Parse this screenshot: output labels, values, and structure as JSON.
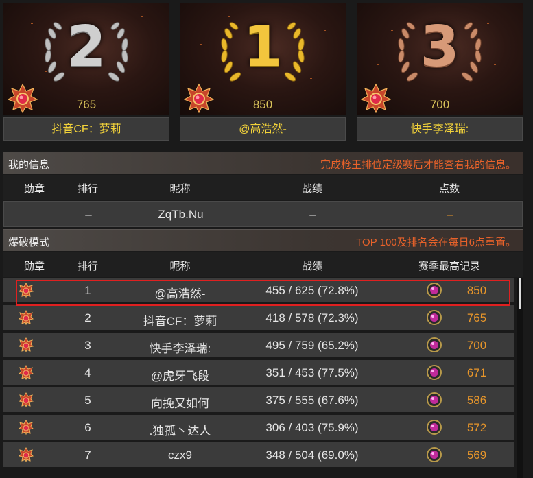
{
  "podium": [
    {
      "place": "2",
      "score": "765",
      "name": "抖音CF：萝莉"
    },
    {
      "place": "1",
      "score": "850",
      "name": "@高浩然-"
    },
    {
      "place": "3",
      "score": "700",
      "name": "快手李泽瑞:"
    }
  ],
  "my_info": {
    "title": "我的信息",
    "notice": "完成枪王排位定级赛后才能查看我的信息。",
    "headers": {
      "medal": "勋章",
      "rank": "排行",
      "name": "昵称",
      "record": "战绩",
      "points": "点数"
    },
    "row": {
      "rank": "–",
      "name": "ZqTb.Nu",
      "record": "–",
      "points": "–"
    }
  },
  "mode": {
    "title": "爆破模式",
    "notice": "TOP 100及排名会在每日6点重置。",
    "headers": {
      "medal": "勋章",
      "rank": "排行",
      "name": "昵称",
      "record": "战绩",
      "points": "赛季最高记录"
    }
  },
  "leaderboard": [
    {
      "rank": "1",
      "name": "@高浩然-",
      "record": "455 / 625 (72.8%)",
      "points": "850"
    },
    {
      "rank": "2",
      "name": "抖音CF：萝莉",
      "record": "418 / 578 (72.3%)",
      "points": "765"
    },
    {
      "rank": "3",
      "name": "快手李泽瑞:",
      "record": "495 / 759 (65.2%)",
      "points": "700"
    },
    {
      "rank": "4",
      "name": "@虎牙飞段",
      "record": "351 / 453 (77.5%)",
      "points": "671"
    },
    {
      "rank": "5",
      "name": "向挽又如何",
      "record": "375 / 555 (67.6%)",
      "points": "586"
    },
    {
      "rank": "6",
      "name": ".独孤丶达人",
      "record": "306 / 403 (75.9%)",
      "points": "572"
    },
    {
      "rank": "7",
      "name": "czx9",
      "record": "348 / 504 (69.0%)",
      "points": "569"
    }
  ],
  "colors": {
    "gold": "#f2d23a",
    "points": "#e8962a",
    "notice": "#e8622a",
    "highlight": "#e02020"
  }
}
